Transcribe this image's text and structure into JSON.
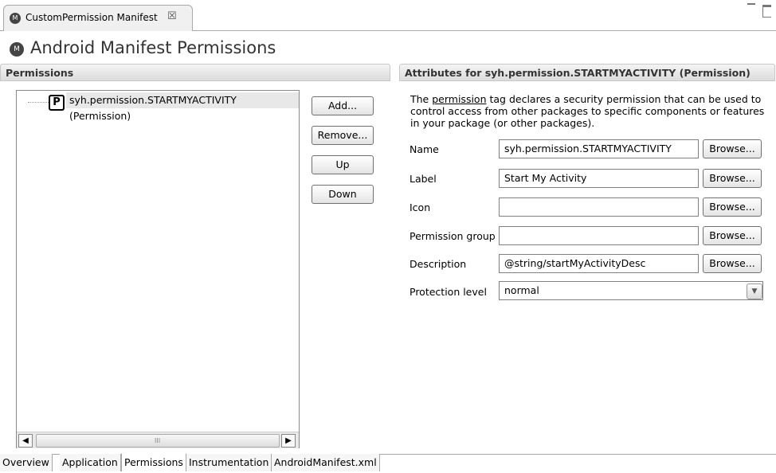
{
  "editor": {
    "tab_title": "CustomPermission Manifest",
    "tab_icon": "android-manifest-icon",
    "close_glyph": "☒"
  },
  "page": {
    "title": "Android Manifest Permissions"
  },
  "permissions_section": {
    "header": "Permissions",
    "tree_items": [
      {
        "badge": "P",
        "label": "syh.permission.STARTMYACTIVITY (Permission)",
        "selected": true
      }
    ],
    "buttons": {
      "add": "Add...",
      "remove": "Remove...",
      "up": "Up",
      "down": "Down"
    },
    "scroll_grip": "III"
  },
  "attributes_section": {
    "header": "Attributes for syh.permission.STARTMYACTIVITY (Permission)",
    "description_link": "permission",
    "description_rest": " tag declares a security permission that can be used to control access from other packages to specific components or features in your package (or other packages).",
    "description_prefix": "The ",
    "browse_label": "Browse...",
    "fields": {
      "name": {
        "label": "Name",
        "value": "syh.permission.STARTMYACTIVITY"
      },
      "label": {
        "label": "Label",
        "value": "Start My Activity"
      },
      "icon": {
        "label": "Icon",
        "value": ""
      },
      "permission_group": {
        "label": "Permission group",
        "value": ""
      },
      "description": {
        "label": "Description",
        "value": "@string/startMyActivityDesc"
      }
    },
    "protection_level": {
      "label": "Protection level",
      "value": "normal"
    }
  },
  "bottom_tabs": [
    {
      "label": "Overview",
      "active": false
    },
    {
      "label": "Application",
      "active": false
    },
    {
      "label": "Permissions",
      "active": true
    },
    {
      "label": "Instrumentation",
      "active": false
    },
    {
      "label": "AndroidManifest.xml",
      "active": false
    }
  ]
}
